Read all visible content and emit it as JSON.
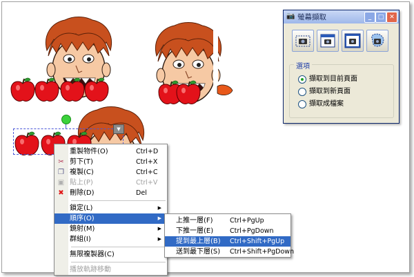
{
  "screen": {
    "background": "#ffffff",
    "accent": "#316ac5"
  },
  "context_menu": {
    "items": [
      {
        "label": "重製物件(O)",
        "shortcut": "Ctrl+D",
        "icon": "none",
        "disabled": false
      },
      {
        "label": "剪下(T)",
        "shortcut": "Ctrl+X",
        "icon": "scissors-icon",
        "disabled": false
      },
      {
        "label": "複製(C)",
        "shortcut": "Ctrl+C",
        "icon": "copy-icon",
        "disabled": false
      },
      {
        "label": "貼上(P)",
        "shortcut": "Ctrl+V",
        "icon": "paste-icon",
        "disabled": true
      },
      {
        "label": "刪除(D)",
        "shortcut": "Del",
        "icon": "delete-x-icon",
        "disabled": false
      },
      {
        "label": "鎖定(L)",
        "submenu": true
      },
      {
        "label": "順序(O)",
        "submenu": true,
        "highlighted": true
      },
      {
        "label": "鏡射(M)",
        "submenu": true
      },
      {
        "label": "群組(I)",
        "submenu": true
      },
      {
        "label": "無限複製器(C)"
      },
      {
        "label": "播放軌跡移動",
        "disabled": true
      }
    ]
  },
  "order_submenu": {
    "items": [
      {
        "label": "上推一層(F)",
        "shortcut": "Ctrl+PgUp"
      },
      {
        "label": "下推一層(E)",
        "shortcut": "Ctrl+PgDown"
      },
      {
        "label": "提到最上層(B)",
        "shortcut": "Ctrl+Shift+PgUp",
        "highlighted": true
      },
      {
        "label": "送到最下層(S)",
        "shortcut": "Ctrl+Shift+PgDown"
      }
    ]
  },
  "capture_dialog": {
    "title": "螢幕擷取",
    "title_buttons": [
      "minimize",
      "maximize",
      "close"
    ],
    "capture_buttons": [
      "capture-area-icon",
      "capture-window-icon",
      "capture-fullscreen-icon",
      "capture-freehand-icon"
    ],
    "options_legend": "選項",
    "options": [
      {
        "label": "擷取到目前頁面",
        "selected": true
      },
      {
        "label": "擷取到新頁面",
        "selected": false
      },
      {
        "label": "擷取成檔案",
        "selected": false
      }
    ]
  }
}
